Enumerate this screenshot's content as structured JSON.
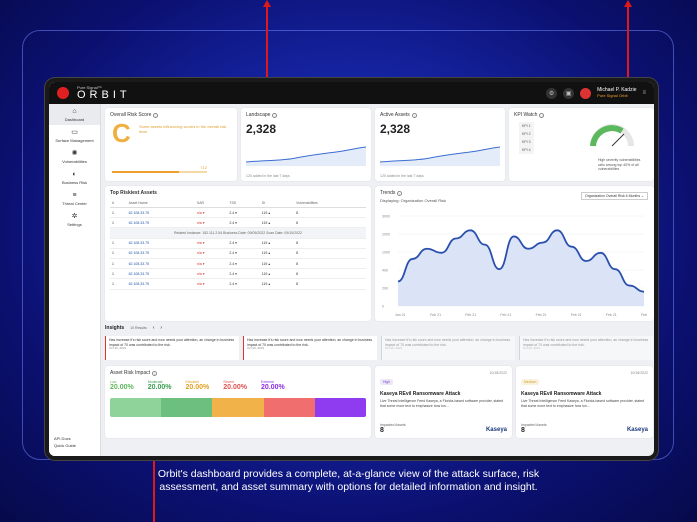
{
  "app": {
    "brand_small": "Pure Signal™",
    "brand_name": "ORBIT",
    "user_name": "Michael P. Kadzie",
    "user_org": "Pure Signal Orbit"
  },
  "sidebar": {
    "items": [
      {
        "label": "Dashboard",
        "icon": "home-icon",
        "glyph": "⌂"
      },
      {
        "label": "Surface Management",
        "icon": "briefcase-icon",
        "glyph": "▭"
      },
      {
        "label": "Vulnerabilities",
        "icon": "bug-icon",
        "glyph": "✺"
      },
      {
        "label": "Business Risk",
        "icon": "toggle-icon",
        "glyph": "◐"
      },
      {
        "label": "Threat Center",
        "icon": "list-icon",
        "glyph": "≡"
      },
      {
        "label": "Settings",
        "icon": "gear-icon",
        "glyph": "✲"
      }
    ],
    "footer": {
      "api": "API Docs",
      "quick": "Quick Guide"
    }
  },
  "overall_risk": {
    "title": "Overall Risk Score",
    "grade": "C",
    "text": "Some assets influencing scores in the overall risk level",
    "score": "712",
    "score_fraction": 0.7
  },
  "landscape": {
    "title": "Landscape",
    "value": "2,328",
    "note": "120 added in the last 7 days"
  },
  "active_assets": {
    "title": "Active Assets",
    "value": "2,328",
    "note": "120 added in the last 7 days"
  },
  "kpi": {
    "title": "KPI Watch",
    "ids": [
      "KPI 1",
      "KPI 2",
      "KPI 3",
      "KPI 4"
    ],
    "desc": "High severity vulnerabilities ratio among top 40% of all vulnerabilities"
  },
  "riskiest": {
    "title": "Top Riskiest Assets",
    "headers": [
      "#",
      "Asset Name",
      "SAR",
      "TSS",
      "SI",
      "Vulnerabilities"
    ],
    "rows": [
      [
        "1",
        "62.108.33.75",
        "n/a ▾",
        "2.4 ▾",
        "119 ▴",
        "8"
      ],
      [
        "1",
        "62.108.33.75",
        "n/a ▾",
        "2.4 ▾",
        "119 ▴",
        "8"
      ],
      [
        "1",
        "62.108.33.75",
        "n/a ▾",
        "2.4 ▾",
        "119 ▴",
        "8"
      ],
      [
        "1",
        "62.108.33.75",
        "n/a ▾",
        "2.4 ▾",
        "119 ▴",
        "8"
      ],
      [
        "1",
        "62.108.33.75",
        "n/a ▾",
        "2.4 ▾",
        "119 ▴",
        "8"
      ],
      [
        "1",
        "62.108.33.75",
        "n/a ▾",
        "2.4 ▾",
        "119 ▴",
        "8"
      ],
      [
        "1",
        "62.108.33.75",
        "n/a ▾",
        "2.4 ▾",
        "119 ▴",
        "8"
      ]
    ],
    "expanded": "Related Instance: 152.111.2.54     Business Date: 09/05/2022     Scan Date: 09/10/2022"
  },
  "trends": {
    "title": "Trends",
    "subtitle": "Displaying: Organization Overall Risk",
    "select": "Organization Overall Risk     6 Months ⌄",
    "chart_data": {
      "type": "area",
      "y_ticks": [
        "3000",
        "2000",
        "1000",
        "400",
        "200",
        "0"
      ],
      "x_ticks": [
        "Jan 21",
        "Feb 21",
        "Feb 21",
        "Feb 21",
        "Feb 21",
        "Feb 21",
        "Feb 21",
        "Feb 21"
      ],
      "values": [
        600,
        1150,
        1400,
        1300,
        1650,
        1850,
        1500,
        900,
        1700,
        1400,
        1550,
        1850,
        1450,
        1100,
        1300,
        900,
        500,
        350
      ]
    }
  },
  "insights": {
    "title": "Insights",
    "filter": "10 Results",
    "cards": [
      {
        "text": "Has increase it's risk score and now needs your attention, an change in business impact of 70 was contributed to the risk.",
        "date": "Oct 26, 2021"
      },
      {
        "text": "Has increase it's risk score and now needs your attention, an change in business impact of 70 was contributed to the risk.",
        "date": "Oct 26, 2021"
      },
      {
        "text": "Has increase it's risk score and now needs your attention, an change in business impact of 70 was contributed to the risk.",
        "date": "Oct 26, 2021"
      },
      {
        "text": "Has increase it's risk score and now needs your attention, an change in business impact of 70 was contributed to the risk.",
        "date": "Oct 26, 2021"
      }
    ]
  },
  "asset_risk": {
    "title": "Asset Risk Impact",
    "levels": [
      {
        "name": "Low",
        "pct": "20.00%",
        "color": "#5cb85c"
      },
      {
        "name": "Moderate",
        "pct": "20.00%",
        "color": "#3aa050"
      },
      {
        "name": "Elevated",
        "pct": "20.00%",
        "color": "#e0a020"
      },
      {
        "name": "Severe",
        "pct": "20.00%",
        "color": "#e05050"
      },
      {
        "name": "Extreme",
        "pct": "20.00%",
        "color": "#8a2be2"
      }
    ],
    "bar_colors": [
      "#8fd39b",
      "#6cbf7f",
      "#f1b24a",
      "#f06e6e",
      "#8f3cf0"
    ]
  },
  "threats": [
    {
      "tag": "High",
      "tag_color": "#7a4cc9",
      "date": "10/18/2022",
      "title": "Kaseya REvil Ransomware Attack",
      "body": "Live Threat Intelligence Feed Kaseya, a Florida-based software provider, stated that some more text to emphasize how lon...",
      "impacted_label": "Impacted Assets",
      "impacted": "8",
      "vendor": "Kaseya"
    },
    {
      "tag": "Medium",
      "tag_color": "#d9a020",
      "date": "10/18/2022",
      "title": "Kaseya REvil Ransomware Attack",
      "body": "Live Threat Intelligence Feed Kaseya, a Florida-based software provider, stated that some more text to emphasize how lon...",
      "impacted_label": "Impacted Assets",
      "impacted": "8",
      "vendor": "Kaseya"
    }
  ],
  "caption": "Orbit's dashboard provides a complete, at-a-glance view of the attack surface, risk assessment, and asset summary with options for detailed information and insight."
}
